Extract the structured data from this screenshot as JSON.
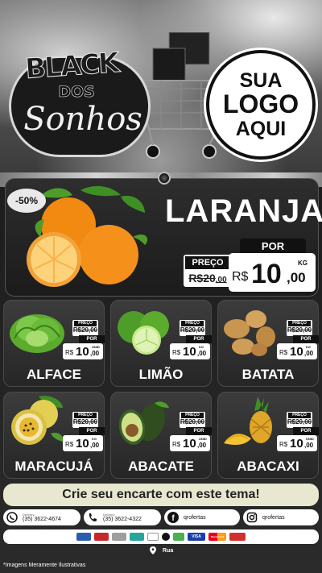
{
  "brand": {
    "line1": "BLACK",
    "line2": "DOS",
    "line3": "Sonhos"
  },
  "logo": {
    "line1": "SUA",
    "line2": "LOGO",
    "line3": "AQUI"
  },
  "featured": {
    "discount": "-50%",
    "name": "LARANJA",
    "preco_label": "PREÇO",
    "old_price_int": "R$20",
    "old_price_dec": ",00",
    "por_label": "POR",
    "currency": "R$",
    "new_price_int": "10",
    "new_price_dec": ",00",
    "unit": "KG"
  },
  "products": [
    {
      "name": "ALFACE",
      "preco_label": "PREÇO",
      "old_price": "R$20,00",
      "por_label": "POR",
      "currency": "R$",
      "price_int": "10",
      "price_dec": ",00",
      "unit": "UNID"
    },
    {
      "name": "LIMÃO",
      "preco_label": "PREÇO",
      "old_price": "R$20,00",
      "por_label": "POR",
      "currency": "R$",
      "price_int": "10",
      "price_dec": ",00",
      "unit": "KG"
    },
    {
      "name": "BATATA",
      "preco_label": "PREÇO",
      "old_price": "R$20,00",
      "por_label": "POR",
      "currency": "R$",
      "price_int": "10",
      "price_dec": ",00",
      "unit": "KG"
    },
    {
      "name": "MARACUJÁ",
      "preco_label": "PREÇO",
      "old_price": "R$20,00",
      "por_label": "POR",
      "currency": "R$",
      "price_int": "10",
      "price_dec": ",00",
      "unit": "KG"
    },
    {
      "name": "ABACATE",
      "preco_label": "PREÇO",
      "old_price": "R$20,00",
      "por_label": "POR",
      "currency": "R$",
      "price_int": "10",
      "price_dec": ",00",
      "unit": "UNID"
    },
    {
      "name": "ABACAXI",
      "preco_label": "PREÇO",
      "old_price": "R$20,00",
      "por_label": "POR",
      "currency": "R$",
      "price_int": "10",
      "price_dec": ",00",
      "unit": "UNID"
    }
  ],
  "cta": "Crie seu encarte com este tema!",
  "contacts": {
    "delivery1_label": "Delivery",
    "delivery1_number": "(35) 3622-4674",
    "delivery2_label": "Delivery",
    "delivery2_number": "(35) 3622-4322",
    "facebook": "qrofertas",
    "instagram": "qrofertas"
  },
  "payments": [
    "VISA",
    "MasterCard"
  ],
  "address": "Rua",
  "disclaimer": "*Imagens Meramente Ilustrativas",
  "colors": {
    "background": "#2b2b2b",
    "white": "#ffffff",
    "orange": "#f28a12",
    "green": "#5bab2c",
    "cta_bg": "#e8e8d0"
  },
  "icons": [
    "whatsapp-icon",
    "phone-icon",
    "facebook-icon",
    "instagram-icon",
    "location-pin-icon"
  ]
}
